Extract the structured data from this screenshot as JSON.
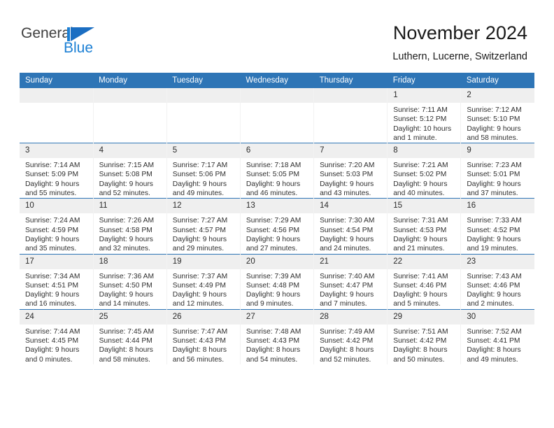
{
  "brand": {
    "name_part1": "General",
    "name_part2": "Blue",
    "accent_color": "#1b7fd4"
  },
  "header": {
    "title": "November 2024",
    "subtitle": "Luthern, Lucerne, Switzerland",
    "header_bg_color": "#2e75b6"
  },
  "weekdays": [
    "Sunday",
    "Monday",
    "Tuesday",
    "Wednesday",
    "Thursday",
    "Friday",
    "Saturday"
  ],
  "weeks": [
    [
      {
        "day": "",
        "empty": true,
        "sunrise": "",
        "sunset": "",
        "daylight1": "",
        "daylight2": ""
      },
      {
        "day": "",
        "empty": true,
        "sunrise": "",
        "sunset": "",
        "daylight1": "",
        "daylight2": ""
      },
      {
        "day": "",
        "empty": true,
        "sunrise": "",
        "sunset": "",
        "daylight1": "",
        "daylight2": ""
      },
      {
        "day": "",
        "empty": true,
        "sunrise": "",
        "sunset": "",
        "daylight1": "",
        "daylight2": ""
      },
      {
        "day": "",
        "empty": true,
        "sunrise": "",
        "sunset": "",
        "daylight1": "",
        "daylight2": ""
      },
      {
        "day": "1",
        "empty": false,
        "sunrise": "Sunrise: 7:11 AM",
        "sunset": "Sunset: 5:12 PM",
        "daylight1": "Daylight: 10 hours",
        "daylight2": "and 1 minute."
      },
      {
        "day": "2",
        "empty": false,
        "sunrise": "Sunrise: 7:12 AM",
        "sunset": "Sunset: 5:10 PM",
        "daylight1": "Daylight: 9 hours",
        "daylight2": "and 58 minutes."
      }
    ],
    [
      {
        "day": "3",
        "empty": false,
        "sunrise": "Sunrise: 7:14 AM",
        "sunset": "Sunset: 5:09 PM",
        "daylight1": "Daylight: 9 hours",
        "daylight2": "and 55 minutes."
      },
      {
        "day": "4",
        "empty": false,
        "sunrise": "Sunrise: 7:15 AM",
        "sunset": "Sunset: 5:08 PM",
        "daylight1": "Daylight: 9 hours",
        "daylight2": "and 52 minutes."
      },
      {
        "day": "5",
        "empty": false,
        "sunrise": "Sunrise: 7:17 AM",
        "sunset": "Sunset: 5:06 PM",
        "daylight1": "Daylight: 9 hours",
        "daylight2": "and 49 minutes."
      },
      {
        "day": "6",
        "empty": false,
        "sunrise": "Sunrise: 7:18 AM",
        "sunset": "Sunset: 5:05 PM",
        "daylight1": "Daylight: 9 hours",
        "daylight2": "and 46 minutes."
      },
      {
        "day": "7",
        "empty": false,
        "sunrise": "Sunrise: 7:20 AM",
        "sunset": "Sunset: 5:03 PM",
        "daylight1": "Daylight: 9 hours",
        "daylight2": "and 43 minutes."
      },
      {
        "day": "8",
        "empty": false,
        "sunrise": "Sunrise: 7:21 AM",
        "sunset": "Sunset: 5:02 PM",
        "daylight1": "Daylight: 9 hours",
        "daylight2": "and 40 minutes."
      },
      {
        "day": "9",
        "empty": false,
        "sunrise": "Sunrise: 7:23 AM",
        "sunset": "Sunset: 5:01 PM",
        "daylight1": "Daylight: 9 hours",
        "daylight2": "and 37 minutes."
      }
    ],
    [
      {
        "day": "10",
        "empty": false,
        "sunrise": "Sunrise: 7:24 AM",
        "sunset": "Sunset: 4:59 PM",
        "daylight1": "Daylight: 9 hours",
        "daylight2": "and 35 minutes."
      },
      {
        "day": "11",
        "empty": false,
        "sunrise": "Sunrise: 7:26 AM",
        "sunset": "Sunset: 4:58 PM",
        "daylight1": "Daylight: 9 hours",
        "daylight2": "and 32 minutes."
      },
      {
        "day": "12",
        "empty": false,
        "sunrise": "Sunrise: 7:27 AM",
        "sunset": "Sunset: 4:57 PM",
        "daylight1": "Daylight: 9 hours",
        "daylight2": "and 29 minutes."
      },
      {
        "day": "13",
        "empty": false,
        "sunrise": "Sunrise: 7:29 AM",
        "sunset": "Sunset: 4:56 PM",
        "daylight1": "Daylight: 9 hours",
        "daylight2": "and 27 minutes."
      },
      {
        "day": "14",
        "empty": false,
        "sunrise": "Sunrise: 7:30 AM",
        "sunset": "Sunset: 4:54 PM",
        "daylight1": "Daylight: 9 hours",
        "daylight2": "and 24 minutes."
      },
      {
        "day": "15",
        "empty": false,
        "sunrise": "Sunrise: 7:31 AM",
        "sunset": "Sunset: 4:53 PM",
        "daylight1": "Daylight: 9 hours",
        "daylight2": "and 21 minutes."
      },
      {
        "day": "16",
        "empty": false,
        "sunrise": "Sunrise: 7:33 AM",
        "sunset": "Sunset: 4:52 PM",
        "daylight1": "Daylight: 9 hours",
        "daylight2": "and 19 minutes."
      }
    ],
    [
      {
        "day": "17",
        "empty": false,
        "sunrise": "Sunrise: 7:34 AM",
        "sunset": "Sunset: 4:51 PM",
        "daylight1": "Daylight: 9 hours",
        "daylight2": "and 16 minutes."
      },
      {
        "day": "18",
        "empty": false,
        "sunrise": "Sunrise: 7:36 AM",
        "sunset": "Sunset: 4:50 PM",
        "daylight1": "Daylight: 9 hours",
        "daylight2": "and 14 minutes."
      },
      {
        "day": "19",
        "empty": false,
        "sunrise": "Sunrise: 7:37 AM",
        "sunset": "Sunset: 4:49 PM",
        "daylight1": "Daylight: 9 hours",
        "daylight2": "and 12 minutes."
      },
      {
        "day": "20",
        "empty": false,
        "sunrise": "Sunrise: 7:39 AM",
        "sunset": "Sunset: 4:48 PM",
        "daylight1": "Daylight: 9 hours",
        "daylight2": "and 9 minutes."
      },
      {
        "day": "21",
        "empty": false,
        "sunrise": "Sunrise: 7:40 AM",
        "sunset": "Sunset: 4:47 PM",
        "daylight1": "Daylight: 9 hours",
        "daylight2": "and 7 minutes."
      },
      {
        "day": "22",
        "empty": false,
        "sunrise": "Sunrise: 7:41 AM",
        "sunset": "Sunset: 4:46 PM",
        "daylight1": "Daylight: 9 hours",
        "daylight2": "and 5 minutes."
      },
      {
        "day": "23",
        "empty": false,
        "sunrise": "Sunrise: 7:43 AM",
        "sunset": "Sunset: 4:46 PM",
        "daylight1": "Daylight: 9 hours",
        "daylight2": "and 2 minutes."
      }
    ],
    [
      {
        "day": "24",
        "empty": false,
        "sunrise": "Sunrise: 7:44 AM",
        "sunset": "Sunset: 4:45 PM",
        "daylight1": "Daylight: 9 hours",
        "daylight2": "and 0 minutes."
      },
      {
        "day": "25",
        "empty": false,
        "sunrise": "Sunrise: 7:45 AM",
        "sunset": "Sunset: 4:44 PM",
        "daylight1": "Daylight: 8 hours",
        "daylight2": "and 58 minutes."
      },
      {
        "day": "26",
        "empty": false,
        "sunrise": "Sunrise: 7:47 AM",
        "sunset": "Sunset: 4:43 PM",
        "daylight1": "Daylight: 8 hours",
        "daylight2": "and 56 minutes."
      },
      {
        "day": "27",
        "empty": false,
        "sunrise": "Sunrise: 7:48 AM",
        "sunset": "Sunset: 4:43 PM",
        "daylight1": "Daylight: 8 hours",
        "daylight2": "and 54 minutes."
      },
      {
        "day": "28",
        "empty": false,
        "sunrise": "Sunrise: 7:49 AM",
        "sunset": "Sunset: 4:42 PM",
        "daylight1": "Daylight: 8 hours",
        "daylight2": "and 52 minutes."
      },
      {
        "day": "29",
        "empty": false,
        "sunrise": "Sunrise: 7:51 AM",
        "sunset": "Sunset: 4:42 PM",
        "daylight1": "Daylight: 8 hours",
        "daylight2": "and 50 minutes."
      },
      {
        "day": "30",
        "empty": false,
        "sunrise": "Sunrise: 7:52 AM",
        "sunset": "Sunset: 4:41 PM",
        "daylight1": "Daylight: 8 hours",
        "daylight2": "and 49 minutes."
      }
    ]
  ]
}
